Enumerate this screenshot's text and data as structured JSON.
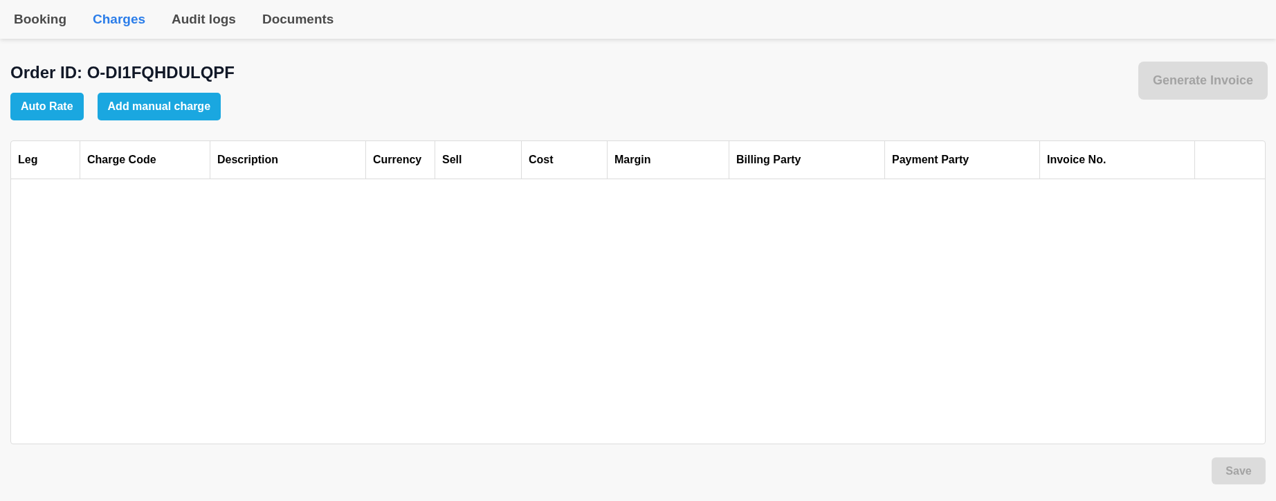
{
  "tabs": [
    {
      "label": "Booking",
      "selected": false
    },
    {
      "label": "Charges",
      "selected": true
    },
    {
      "label": "Audit logs",
      "selected": false
    },
    {
      "label": "Documents",
      "selected": false
    }
  ],
  "order_id": "Order ID: O-DI1FQHDULQPF",
  "actions": [
    {
      "label": "Auto Rate",
      "disabled": false
    },
    {
      "label": "Add manual charge",
      "disabled": false
    }
  ],
  "generate_invoice": {
    "label": "Generate Invoice",
    "disabled": true
  },
  "table": {
    "columns": [
      "Leg",
      "Charge Code",
      "Description",
      "Currency",
      "Sell",
      "Cost",
      "Margin",
      "Billing Party",
      "Payment Party",
      "Invoice No.",
      ""
    ]
  },
  "save": {
    "label": "Save",
    "disabled": true
  }
}
